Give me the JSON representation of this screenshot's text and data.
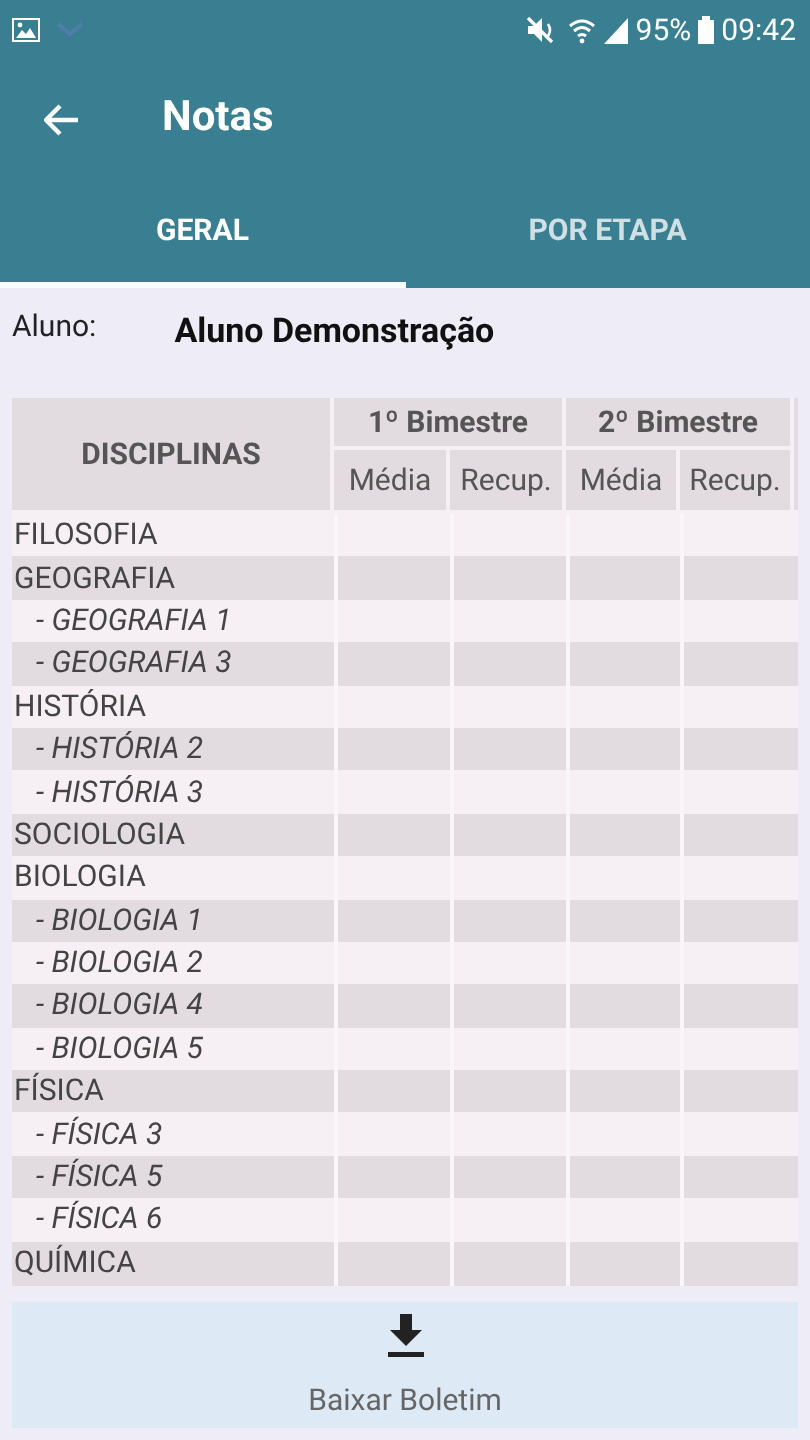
{
  "status_bar": {
    "battery": "95%",
    "time": "09:42"
  },
  "toolbar": {
    "title": "Notas"
  },
  "tabs": [
    {
      "label": "GERAL",
      "selected": true
    },
    {
      "label": "POR ETAPA",
      "selected": false
    }
  ],
  "student": {
    "label": "Aluno:",
    "name": "Aluno Demonstração"
  },
  "table": {
    "first_column": "DISCIPLINAS",
    "periods": [
      {
        "title": "1º Bimestre",
        "columns": [
          "Média",
          "Recup."
        ]
      },
      {
        "title": "2º Bimestre",
        "columns": [
          "Média",
          "Recup."
        ]
      }
    ],
    "rows": [
      {
        "subject": "FILOSOFIA"
      },
      {
        "subject": "GEOGRAFIA",
        "children": [
          {
            "subject": "- GEOGRAFIA 1"
          },
          {
            "subject": "- GEOGRAFIA 3"
          }
        ]
      },
      {
        "subject": "HISTÓRIA",
        "children": [
          {
            "subject": "- HISTÓRIA 2"
          },
          {
            "subject": "- HISTÓRIA 3"
          }
        ]
      },
      {
        "subject": "SOCIOLOGIA"
      },
      {
        "subject": "BIOLOGIA",
        "children": [
          {
            "subject": "- BIOLOGIA 1"
          },
          {
            "subject": "- BIOLOGIA 2"
          },
          {
            "subject": "- BIOLOGIA 4"
          },
          {
            "subject": "- BIOLOGIA 5"
          }
        ]
      },
      {
        "subject": "FÍSICA",
        "children": [
          {
            "subject": "- FÍSICA 3"
          },
          {
            "subject": "- FÍSICA 5"
          },
          {
            "subject": "- FÍSICA 6"
          }
        ]
      },
      {
        "subject": "QUÍMICA"
      }
    ]
  },
  "download_button": {
    "label": "Baixar Boletim"
  }
}
